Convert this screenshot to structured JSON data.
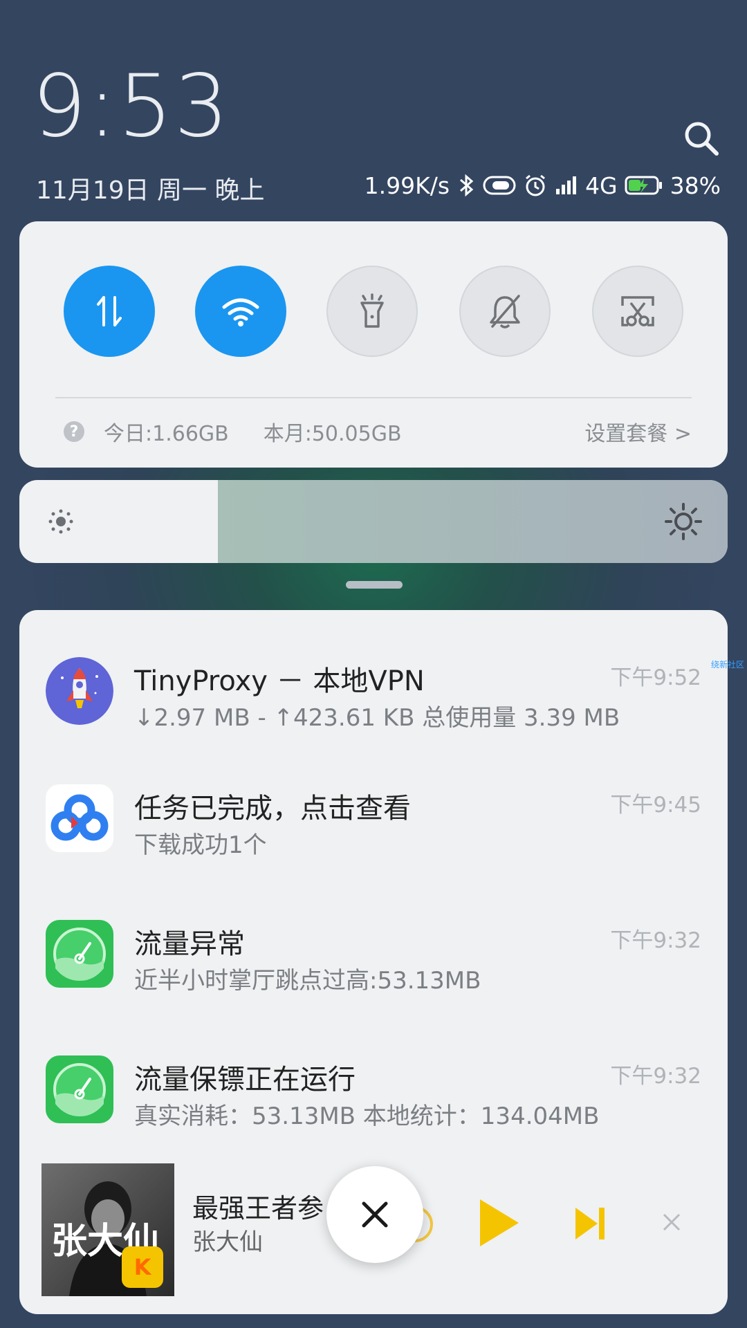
{
  "header": {
    "time": "9:53",
    "date": "11月19日 周一 晚上",
    "net_speed": "1.99K/s",
    "network_type": "4G",
    "battery": "38%",
    "icons": [
      "search-icon",
      "bluetooth-icon",
      "toggle-icon",
      "alarm-icon",
      "signal-icon",
      "battery-charging-icon"
    ]
  },
  "quick_settings": {
    "toggles": [
      {
        "name": "mobile-data",
        "icon": "data-arrows-icon",
        "active": true
      },
      {
        "name": "wifi",
        "icon": "wifi-icon",
        "active": true
      },
      {
        "name": "flashlight",
        "icon": "flashlight-icon",
        "active": false
      },
      {
        "name": "mute",
        "icon": "bell-off-icon",
        "active": false
      },
      {
        "name": "screenshot",
        "icon": "screenshot-icon",
        "active": false
      }
    ],
    "help": "?",
    "today_usage": "今日:1.66GB",
    "month_usage": "本月:50.05GB",
    "plan_link": "设置套餐 >"
  },
  "brightness": {
    "level": 0.72
  },
  "notifications": [
    {
      "app": "TinyProxy",
      "title": "TinyProxy － 本地VPN",
      "subtitle": "↓2.97 MB - ↑423.61 KB 总使用量 3.39 MB",
      "time": "下午9:52",
      "icon": "rocket-icon"
    },
    {
      "app": "Baidu Netdisk",
      "title": "任务已完成，点击查看",
      "subtitle": "下载成功1个",
      "time": "下午9:45",
      "icon": "cloud-icon"
    },
    {
      "app": "Data Guard",
      "title": "流量异常",
      "subtitle": "近半小时掌厅跳点过高:53.13MB",
      "time": "下午9:32",
      "icon": "gauge-icon"
    },
    {
      "app": "Data Guard",
      "title": "流量保镖正在运行",
      "subtitle": "真实消耗：53.13MB   本地统计：134.04MB",
      "time": "下午9:32",
      "icon": "gauge-icon"
    }
  ],
  "side_mark": "绕新社区",
  "media": {
    "title": "最强王者参",
    "artist": "张大仙",
    "album_text": "张大仙",
    "album_badge": "K"
  },
  "colors": {
    "accent": "#1a96f0",
    "media_yellow": "#f5c400",
    "card_bg": "#eff1f3"
  }
}
